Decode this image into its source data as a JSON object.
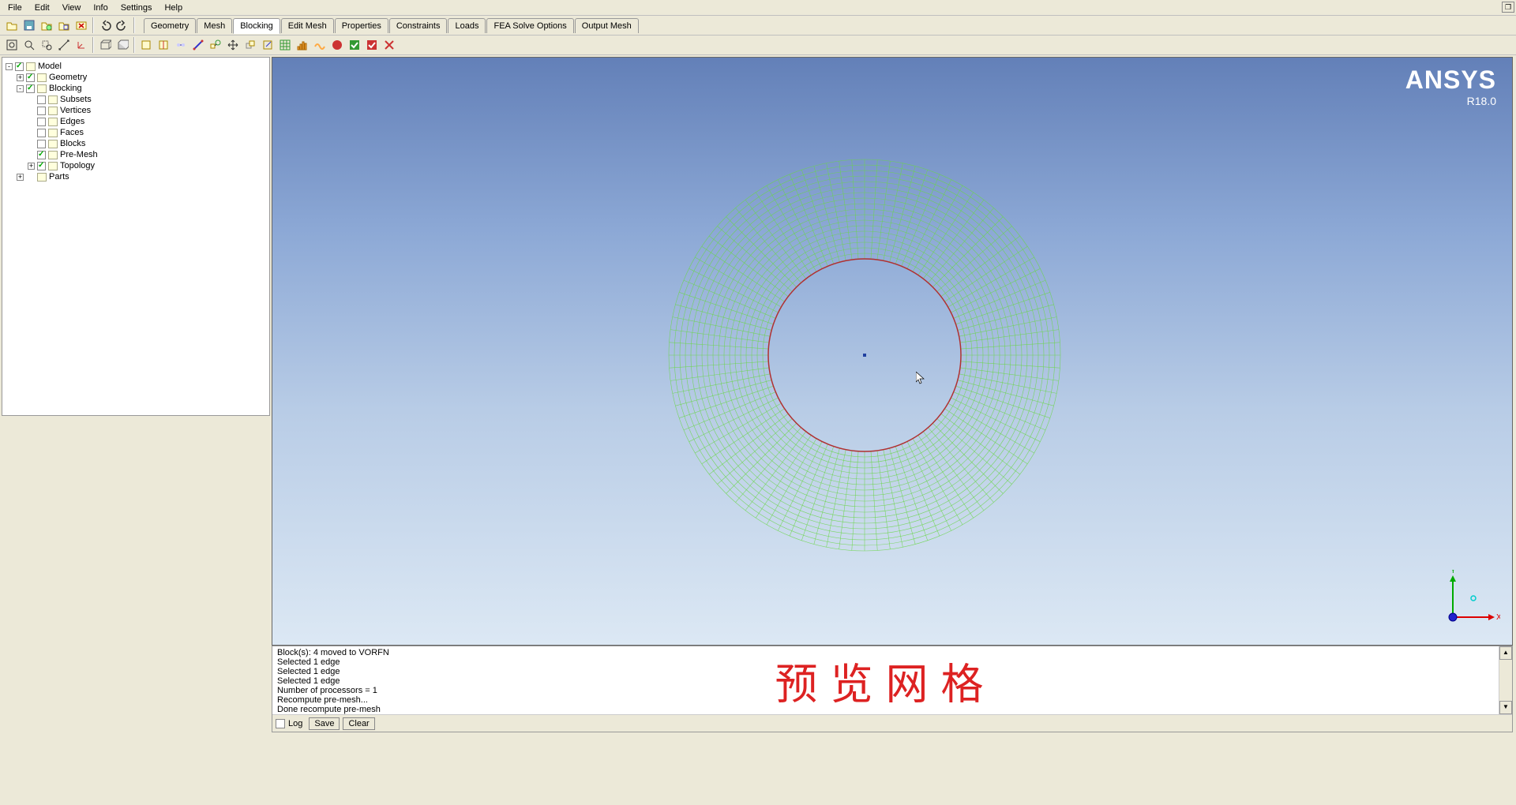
{
  "menubar": {
    "file": "File",
    "edit": "Edit",
    "view": "View",
    "info": "Info",
    "settings": "Settings",
    "help": "Help"
  },
  "tabs": {
    "geometry": "Geometry",
    "mesh": "Mesh",
    "blocking": "Blocking",
    "edit_mesh": "Edit Mesh",
    "properties": "Properties",
    "constraints": "Constraints",
    "loads": "Loads",
    "fea_solve": "FEA Solve Options",
    "output_mesh": "Output Mesh"
  },
  "tree": {
    "model": "Model",
    "geometry": "Geometry",
    "blocking": "Blocking",
    "subsets": "Subsets",
    "vertices": "Vertices",
    "edges": "Edges",
    "faces": "Faces",
    "blocks": "Blocks",
    "pre_mesh": "Pre-Mesh",
    "topology": "Topology",
    "parts": "Parts"
  },
  "brand": {
    "name": "ANSYS",
    "version": "R18.0"
  },
  "triad": {
    "x": "X",
    "y": "Y"
  },
  "log": {
    "l1": "Block(s): 4 moved to VORFN",
    "l2": "Selected 1 edge",
    "l3": "Selected 1 edge",
    "l4": "Selected 1 edge",
    "l5": "Number of processors = 1",
    "l6": "Recompute pre-mesh...",
    "l7": "Done recompute pre-mesh",
    "overlay": "预览网格",
    "log_label": "Log",
    "save": "Save",
    "clear": "Clear"
  }
}
